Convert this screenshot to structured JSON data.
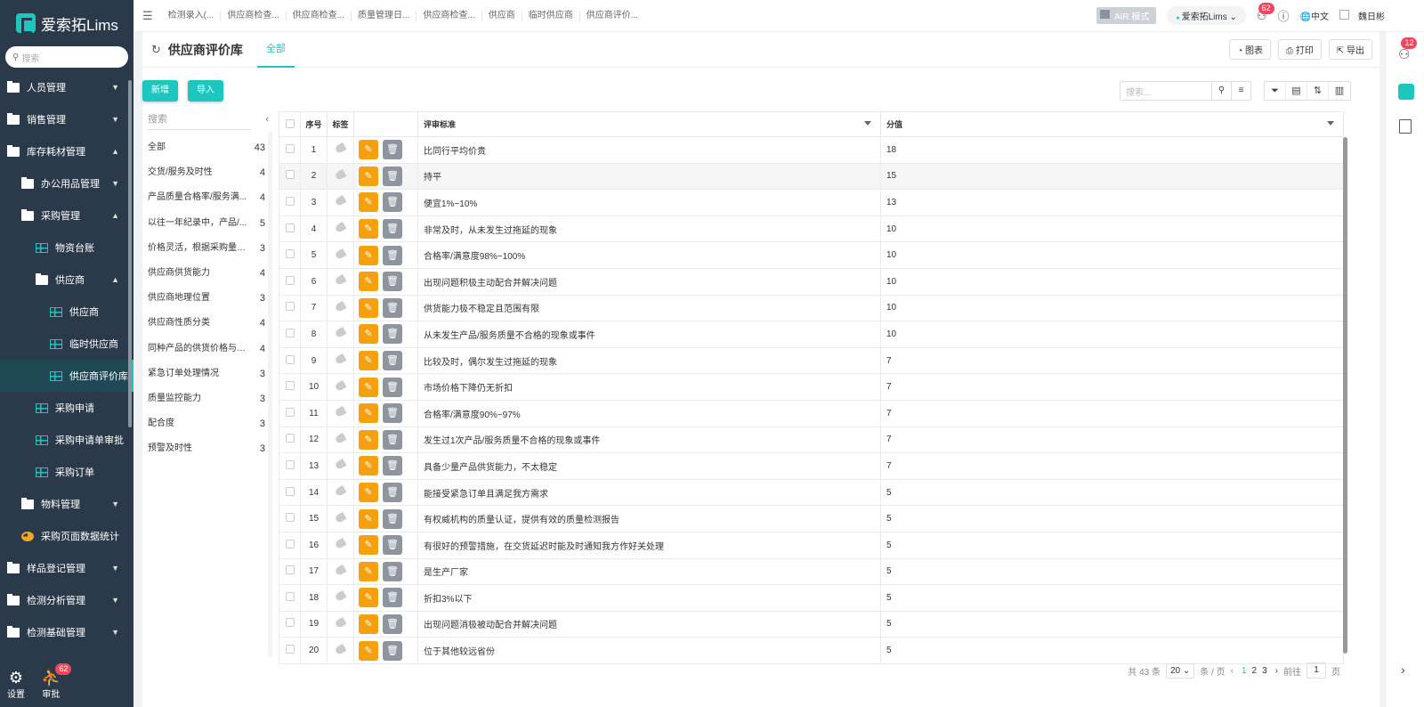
{
  "app": {
    "title": "爱索拓Lims",
    "search_placeholder": "搜索"
  },
  "sidebar": {
    "items": [
      {
        "label": "人员管理",
        "icon": "folder-icon",
        "level": 0,
        "arrow": "▼"
      },
      {
        "label": "销售管理",
        "icon": "folder-icon",
        "level": 0,
        "arrow": "▼"
      },
      {
        "label": "库存耗材管理",
        "icon": "folder-icon",
        "level": 0,
        "arrow": "▲"
      },
      {
        "label": "办公用品管理",
        "icon": "folder-icon",
        "level": 1,
        "arrow": "▼"
      },
      {
        "label": "采购管理",
        "icon": "folder-icon",
        "level": 1,
        "arrow": "▲"
      },
      {
        "label": "物资台账",
        "icon": "grid-icon",
        "level": 2,
        "arrow": ""
      },
      {
        "label": "供应商",
        "icon": "folder-icon",
        "level": 2,
        "arrow": "▲"
      },
      {
        "label": "供应商",
        "icon": "grid-icon",
        "level": 3,
        "arrow": ""
      },
      {
        "label": "临时供应商",
        "icon": "grid-icon",
        "level": 3,
        "arrow": ""
      },
      {
        "label": "供应商评价库",
        "icon": "grid-icon",
        "level": 3,
        "arrow": "",
        "active": true
      },
      {
        "label": "采购申请",
        "icon": "grid-icon",
        "level": 2,
        "arrow": ""
      },
      {
        "label": "采购申请单审批",
        "icon": "grid-icon",
        "level": 2,
        "arrow": ""
      },
      {
        "label": "采购订单",
        "icon": "grid-icon",
        "level": 2,
        "arrow": ""
      },
      {
        "label": "物料管理",
        "icon": "folder-icon",
        "level": 1,
        "arrow": "▼"
      },
      {
        "label": "采购页面数据统计",
        "icon": "pie-icon",
        "level": 1,
        "arrow": ""
      },
      {
        "label": "样品登记管理",
        "icon": "folder-icon",
        "level": 0,
        "arrow": "▼"
      },
      {
        "label": "检测分析管理",
        "icon": "folder-icon",
        "level": 0,
        "arrow": "▼"
      },
      {
        "label": "检测基础管理",
        "icon": "folder-icon",
        "level": 0,
        "arrow": "▼"
      }
    ],
    "bottom": {
      "settings": "设置",
      "approve": "审批",
      "approve_badge": "62"
    }
  },
  "topbar": {
    "tabs": [
      "检测录入(...",
      "供应商检查...",
      "供应商检查...",
      "质量管理日...",
      "供应商检查...",
      "供应商",
      "临时供应商",
      "供应商评价..."
    ],
    "air_mode": "AIR 模式",
    "system": "爱索拓Lims",
    "notice_badge": "62",
    "language": "中文",
    "user": "魏日彬",
    "right_badge": "12"
  },
  "page": {
    "title": "供应商评价库",
    "tab": "全部",
    "chart_btn": "图表",
    "print_btn": "打印",
    "export_btn": "导出",
    "add_btn": "新增",
    "import_btn": "导入",
    "table_search_placeholder": "搜索..."
  },
  "categories": {
    "search_placeholder": "搜索",
    "items": [
      {
        "name": "全部",
        "count": "43"
      },
      {
        "name": "交货/服务及时性",
        "count": "4"
      },
      {
        "name": "产品质量合格率/服务满...",
        "count": "4"
      },
      {
        "name": "以往一年纪录中，产品/...",
        "count": "5"
      },
      {
        "name": "价格灵活，根据采购量（...",
        "count": "3"
      },
      {
        "name": "供应商供货能力",
        "count": "4"
      },
      {
        "name": "供应商地理位置",
        "count": "3"
      },
      {
        "name": "供应商性质分类",
        "count": "4"
      },
      {
        "name": "同种产品的供货价格与同...",
        "count": "4"
      },
      {
        "name": "紧急订单处理情况",
        "count": "3"
      },
      {
        "name": "质量监控能力",
        "count": "3"
      },
      {
        "name": "配合度",
        "count": "3"
      },
      {
        "name": "预警及时性",
        "count": "3"
      }
    ]
  },
  "table": {
    "columns": {
      "seq": "序号",
      "tag": "标签",
      "standard": "评审标准",
      "score": "分值"
    },
    "rows": [
      {
        "seq": "1",
        "standard": "比同行平均价贵",
        "score": "18"
      },
      {
        "seq": "2",
        "standard": "持平",
        "score": "15"
      },
      {
        "seq": "3",
        "standard": "便宜1%~10%",
        "score": "13"
      },
      {
        "seq": "4",
        "standard": "非常及时，从未发生过拖延的现象",
        "score": "10"
      },
      {
        "seq": "5",
        "standard": "合格率/满意度98%~100%",
        "score": "10"
      },
      {
        "seq": "6",
        "standard": "出现问题积极主动配合并解决问题",
        "score": "10"
      },
      {
        "seq": "7",
        "standard": "供货能力极不稳定且范围有限",
        "score": "10"
      },
      {
        "seq": "8",
        "standard": "从未发生产品/服务质量不合格的现象或事件",
        "score": "10"
      },
      {
        "seq": "9",
        "standard": "比较及时，偶尔发生过拖延的现象",
        "score": "7"
      },
      {
        "seq": "10",
        "standard": "市场价格下降仍无折扣",
        "score": "7"
      },
      {
        "seq": "11",
        "standard": "合格率/满意度90%~97%",
        "score": "7"
      },
      {
        "seq": "12",
        "standard": "发生过1次产品/服务质量不合格的现象或事件",
        "score": "7"
      },
      {
        "seq": "13",
        "standard": "具备少量产品供货能力，不太稳定",
        "score": "7"
      },
      {
        "seq": "14",
        "standard": "能接受紧急订单且满足我方需求",
        "score": "5"
      },
      {
        "seq": "15",
        "standard": "有权威机构的质量认证，提供有效的质量检测报告",
        "score": "5"
      },
      {
        "seq": "16",
        "standard": "有很好的预警措施，在交货延迟时能及时通知我方作好关处理",
        "score": "5"
      },
      {
        "seq": "17",
        "standard": "是生产厂家",
        "score": "5"
      },
      {
        "seq": "18",
        "standard": "折扣3%以下",
        "score": "5"
      },
      {
        "seq": "19",
        "standard": "出现问题消极被动配合并解决问题",
        "score": "5"
      },
      {
        "seq": "20",
        "standard": "位于其他较远省份",
        "score": "5"
      }
    ]
  },
  "pager": {
    "total": "共 43 条",
    "page_size": "20",
    "per_page": "条 / 页",
    "pages": [
      "1",
      "2",
      "3"
    ],
    "goto": "前往",
    "goto_value": "1",
    "page_unit": "页"
  },
  "colors": {
    "accent": "#1ec6c0",
    "sidebar": "#2b3a4a",
    "edit": "#f5a00f",
    "delete": "#8e959f"
  }
}
